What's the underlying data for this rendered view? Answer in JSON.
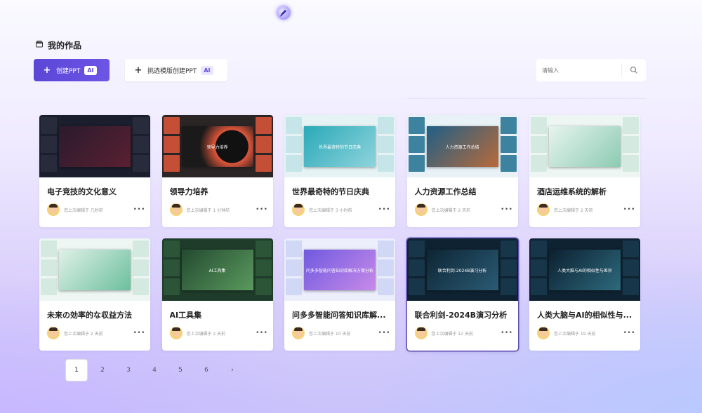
{
  "header": {
    "title": "我的作品"
  },
  "toolbar": {
    "create_label": "创建PPT",
    "ai_badge": "AI",
    "template_label": "挑选模版创建PPT"
  },
  "search": {
    "placeholder": "请输入"
  },
  "cards": [
    {
      "title": "电子竞技的文化意义",
      "time": "您上次编辑于 几秒前",
      "theme": "dark-red",
      "thumb_text": ""
    },
    {
      "title": "领导力培养",
      "time": "您上次编辑于 1 分钟前",
      "theme": "orange",
      "thumb_text": "领导力培养"
    },
    {
      "title": "世界最奇特的节日庆典",
      "time": "您上次编辑于 3 小时前",
      "theme": "teal",
      "thumb_text": "世界最奇特的节日庆典"
    },
    {
      "title": "人力资源工作总结",
      "time": "您上次编辑于 2 天前",
      "theme": "ocean",
      "thumb_text": "人力资源工作总结"
    },
    {
      "title": "酒店运维系统的解析",
      "time": "您上次编辑于 2 天前",
      "theme": "mint",
      "thumb_text": ""
    },
    {
      "title": "未来の効率的な収益方法",
      "time": "您上次编辑于 2 天前",
      "theme": "mint2",
      "thumb_text": ""
    },
    {
      "title": "AI工具集",
      "time": "您上次编辑于 2 天前",
      "theme": "green",
      "thumb_text": "AI工具集"
    },
    {
      "title": "问多多智能问答知识库解...",
      "time": "您上次编辑于 10 天前",
      "theme": "purple",
      "thumb_text": "问多多智能问答知识库解决方案分析"
    },
    {
      "title": "联合利剑-2024B演习分析",
      "time": "您上次编辑于 12 天前",
      "theme": "navy",
      "thumb_text": "联合利剑-2024B演习分析"
    },
    {
      "title": "人类大脑与AI的相似性与...",
      "time": "您上次编辑于 19 天前",
      "theme": "navy2",
      "thumb_text": "人类大脑与AI的相似性与差异"
    }
  ],
  "pagination": {
    "pages": [
      "1",
      "2",
      "3",
      "4",
      "5",
      "6"
    ],
    "current": "1",
    "prev": "‹",
    "next": "›"
  },
  "colors": {
    "accent": "#5b46d6",
    "active_card_border": "#5a4bb0"
  },
  "icons": {
    "folder": "folder-icon",
    "search": "search-icon",
    "logo": "pen-logo-icon",
    "more": "more-dots-icon"
  }
}
